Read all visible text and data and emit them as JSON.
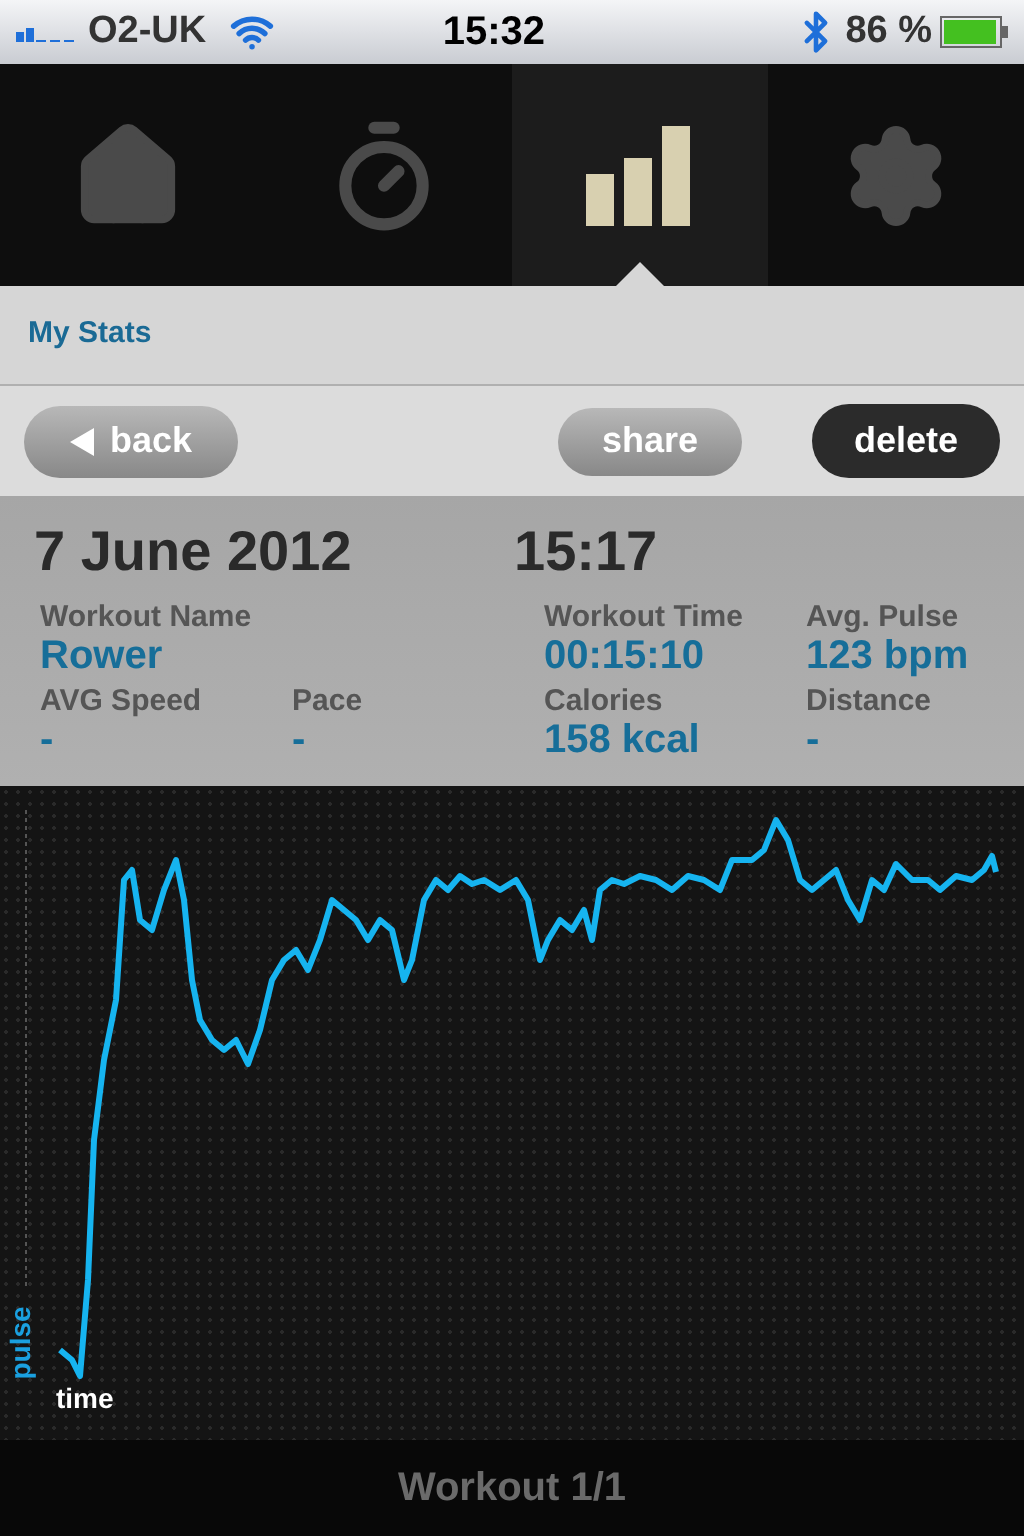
{
  "status_bar": {
    "carrier": "O2-UK",
    "time": "15:32",
    "battery": "86 %"
  },
  "tabs": [
    {
      "kind": "home",
      "selected": false
    },
    {
      "kind": "stopwatch",
      "selected": false
    },
    {
      "kind": "stats",
      "selected": true
    },
    {
      "kind": "settings",
      "selected": false
    }
  ],
  "section_title": "My Stats",
  "toolbar": {
    "back": "back",
    "share": "share",
    "delete": "delete"
  },
  "workout": {
    "date": "7 June 2012",
    "time": "15:17",
    "stats": [
      {
        "label": "Workout Name",
        "value": "Rower",
        "kind": "wide"
      },
      {
        "label": "Workout Time",
        "value": "00:15:10",
        "kind": "normal"
      },
      {
        "label": "Avg. Pulse",
        "value": "123 bpm",
        "kind": "normal"
      },
      {
        "label": "AVG Speed",
        "value": "-",
        "kind": "normal"
      },
      {
        "label": "Pace",
        "value": "-",
        "kind": "normal"
      },
      {
        "label": "Calories",
        "value": "158 kcal",
        "kind": "normal"
      },
      {
        "label": "Distance",
        "value": "-",
        "kind": "normal"
      }
    ]
  },
  "chart": {
    "y_axis_label": "pulse",
    "x_axis_label": "time"
  },
  "footer": "Workout 1/1"
}
